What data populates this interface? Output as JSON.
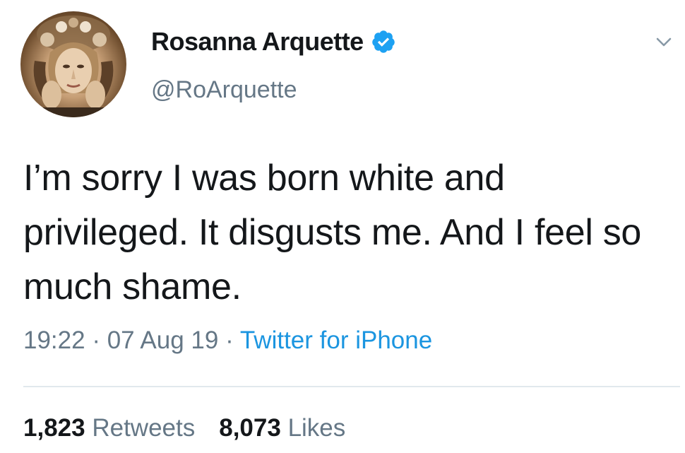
{
  "author": {
    "display_name": "Rosanna Arquette",
    "handle": "@RoArquette",
    "verified": true
  },
  "tweet": {
    "text": "I’m sorry I was born white and privileged. It disgusts me. And I feel so much shame.",
    "time": "19:22",
    "date": "07 Aug 19",
    "separator": " · ",
    "source": "Twitter for iPhone"
  },
  "stats": {
    "retweets_count": "1,823",
    "retweets_label": "Retweets",
    "likes_count": "8,073",
    "likes_label": "Likes"
  },
  "colors": {
    "text_primary": "#14171a",
    "text_secondary": "#657786",
    "accent": "#1b95e0",
    "verified_badge": "#1da1f2",
    "divider": "#e1e8ed"
  },
  "icons": {
    "verified": "verified-badge-icon",
    "caret": "chevron-down-icon"
  }
}
